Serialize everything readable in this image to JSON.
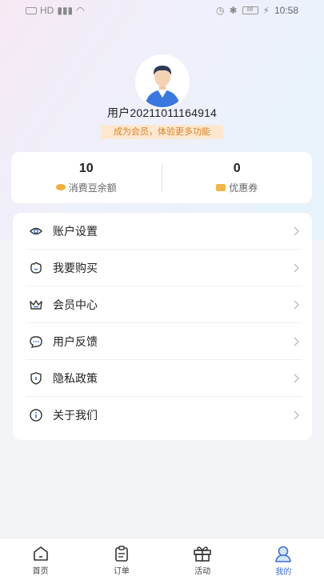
{
  "status_bar": {
    "carrier": "HD",
    "battery": "88",
    "time": "10:58"
  },
  "profile": {
    "username": "用户20211011164914",
    "member_tip": "成为会员，体验更多功能"
  },
  "stats": [
    {
      "value": "10",
      "label": "消费豆余额",
      "icon": "coin-icon"
    },
    {
      "value": "0",
      "label": "优惠券",
      "icon": "coupon-icon"
    }
  ],
  "menu": [
    {
      "label": "账户设置",
      "icon": "eye-icon"
    },
    {
      "label": "我要购买",
      "icon": "bag-icon"
    },
    {
      "label": "会员中心",
      "icon": "crown-icon"
    },
    {
      "label": "用户反馈",
      "icon": "chat-icon"
    },
    {
      "label": "隐私政策",
      "icon": "shield-icon"
    },
    {
      "label": "关于我们",
      "icon": "info-icon"
    }
  ],
  "tabs": [
    {
      "label": "首页",
      "icon": "home-icon",
      "active": false
    },
    {
      "label": "订单",
      "icon": "order-icon",
      "active": false
    },
    {
      "label": "活动",
      "icon": "gift-icon",
      "active": false
    },
    {
      "label": "我的",
      "icon": "profile-icon",
      "active": true
    }
  ],
  "colors": {
    "accent": "#3b6fd6",
    "member_tip_bg": "#fde8cf",
    "member_tip_text": "#d9822b"
  }
}
